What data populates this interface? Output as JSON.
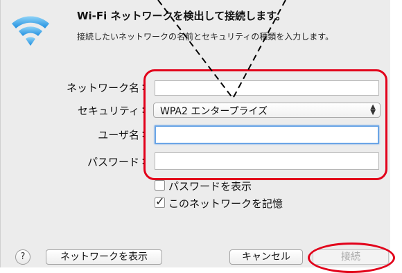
{
  "dialog": {
    "title": "Wi-Fi ネットワークを検出して接続します。",
    "description": "接続したいネットワークの名前とセキュリティの種類を入力します。",
    "icon": "wifi-icon"
  },
  "form": {
    "network_name_label": "ネットワーク名",
    "network_name_value": "",
    "security_label": "セキュリティ",
    "security_value": "WPA2 エンタープライズ",
    "username_label": "ユーザ名",
    "username_value": "",
    "password_label": "パスワード",
    "password_value": "",
    "colon": ":"
  },
  "options": {
    "show_password_label": "パスワードを表示",
    "show_password_checked": false,
    "remember_network_label": "このネットワークを記憶",
    "remember_network_checked": true
  },
  "buttons": {
    "help": "?",
    "show_networks": "ネットワークを表示",
    "cancel": "キャンセル",
    "connect": "接続"
  },
  "annotation": {
    "highlight_color": "#e2001a"
  }
}
